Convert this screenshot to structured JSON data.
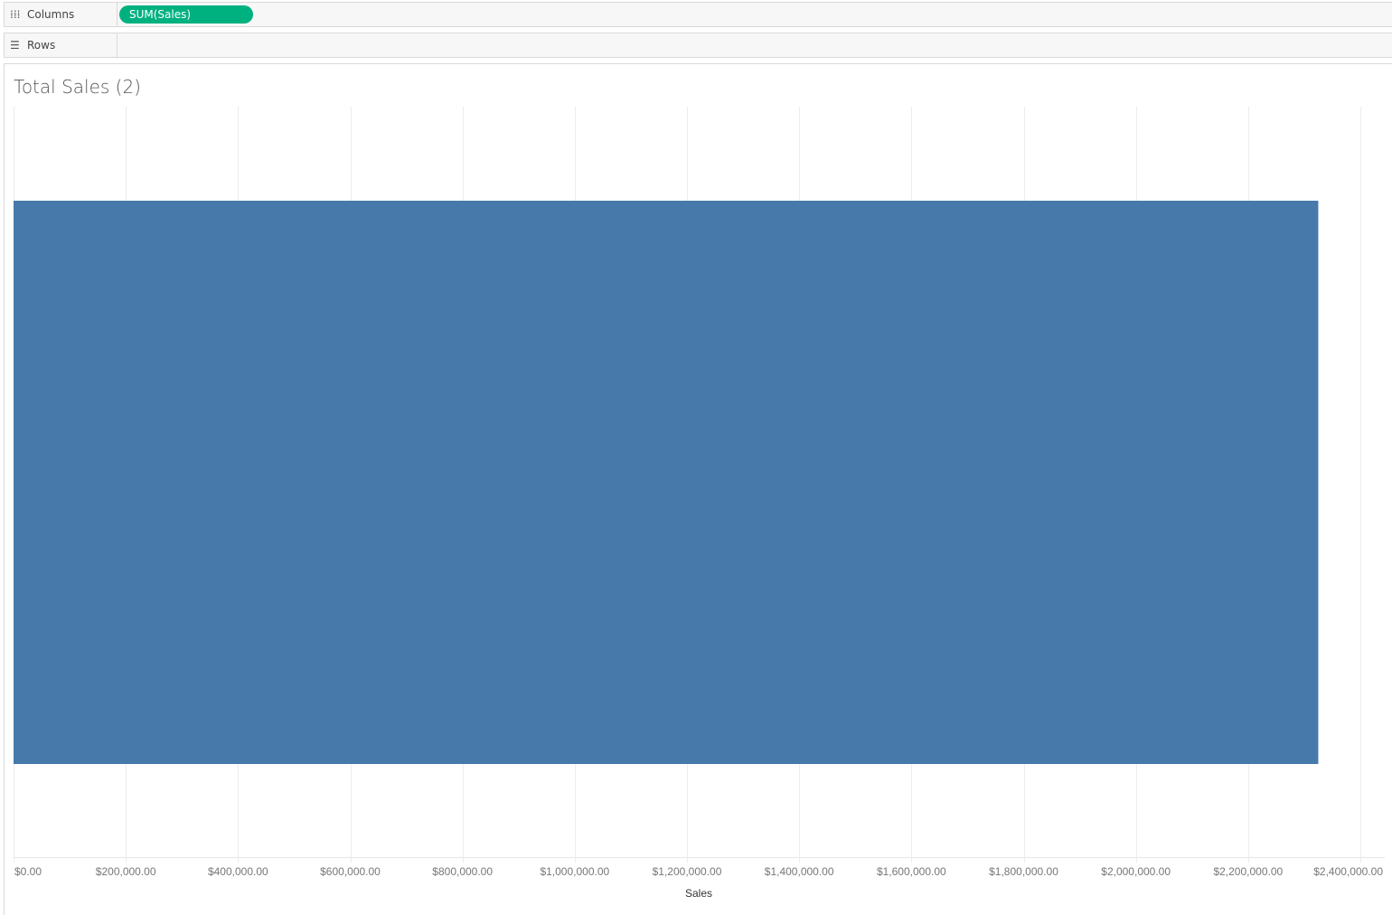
{
  "shelves": {
    "columns": {
      "label": "Columns",
      "icon": "columns-icon",
      "pill": "SUM(Sales)"
    },
    "rows": {
      "label": "Rows",
      "icon": "rows-icon"
    }
  },
  "colors": {
    "bar": "#4779aa",
    "pill": "#00b180",
    "grid": "#ececec"
  },
  "chart_data": {
    "type": "bar",
    "orientation": "horizontal",
    "title": "Total Sales (2)",
    "categories": [
      ""
    ],
    "values": [
      2325000
    ],
    "xlabel": "Sales",
    "ylabel": "",
    "xlim": [
      0,
      2400000
    ],
    "ticks": [
      0,
      200000,
      400000,
      600000,
      800000,
      1000000,
      1200000,
      1400000,
      1600000,
      1800000,
      2000000,
      2200000,
      2400000
    ],
    "tick_labels": [
      "$0.00",
      "$200,000.00",
      "$400,000.00",
      "$600,000.00",
      "$800,000.00",
      "$1,000,000.00",
      "$1,200,000.00",
      "$1,400,000.00",
      "$1,600,000.00",
      "$1,800,000.00",
      "$2,000,000.00",
      "$2,200,000.00",
      "$2,400,000.00"
    ],
    "grid": true,
    "legend": "none"
  }
}
